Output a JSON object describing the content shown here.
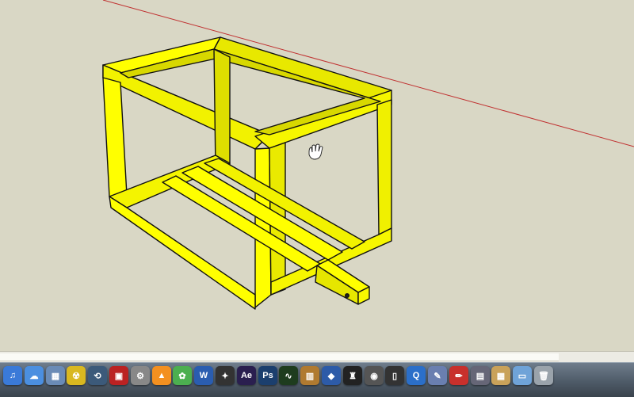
{
  "canvas": {
    "background": "#d9d7c5",
    "model": "yellow box frame",
    "model_color": "#ffff00",
    "edge_color": "#111111",
    "axis_color": "#c03030",
    "cursor": "hand-pan-icon"
  },
  "dock": {
    "items": [
      {
        "name": "itunes-icon",
        "glyph": "♫",
        "bg": "#3a7ad8"
      },
      {
        "name": "ichat-icon",
        "glyph": "☁",
        "bg": "#4b8fe0"
      },
      {
        "name": "preview-icon",
        "glyph": "▦",
        "bg": "#6a8bb6"
      },
      {
        "name": "radiation-app-icon",
        "glyph": "☢",
        "bg": "#d9b820"
      },
      {
        "name": "time-machine-icon",
        "glyph": "⟲",
        "bg": "#3c5a7a"
      },
      {
        "name": "photo-booth-icon",
        "glyph": "▣",
        "bg": "#b22"
      },
      {
        "name": "disk-utility-icon",
        "glyph": "⚙",
        "bg": "#888"
      },
      {
        "name": "vlc-icon",
        "glyph": "▲",
        "bg": "#f39020"
      },
      {
        "name": "green-app-icon",
        "glyph": "✿",
        "bg": "#4caf50"
      },
      {
        "name": "word-icon",
        "glyph": "W",
        "bg": "#2a5db0"
      },
      {
        "name": "star-app-icon",
        "glyph": "✦",
        "bg": "#333"
      },
      {
        "name": "after-effects-icon",
        "glyph": "Ae",
        "bg": "#2a1f4f"
      },
      {
        "name": "photoshop-icon",
        "glyph": "Ps",
        "bg": "#1b3f6e"
      },
      {
        "name": "activity-monitor-icon",
        "glyph": "∿",
        "bg": "#1e3c1e"
      },
      {
        "name": "stuffit-icon",
        "glyph": "▥",
        "bg": "#b07a30"
      },
      {
        "name": "unity-icon",
        "glyph": "◆",
        "bg": "#2d5ba8"
      },
      {
        "name": "top-hat-icon",
        "glyph": "♜",
        "bg": "#222"
      },
      {
        "name": "disc-icon",
        "glyph": "◉",
        "bg": "#555"
      },
      {
        "name": "phone-icon",
        "glyph": "▯",
        "bg": "#333"
      },
      {
        "name": "quicktime-icon",
        "glyph": "Q",
        "bg": "#2b6fc9"
      },
      {
        "name": "xcode-icon",
        "glyph": "✎",
        "bg": "#6a7fb0"
      },
      {
        "name": "pencil-app-icon",
        "glyph": "✏",
        "bg": "#c8302c"
      },
      {
        "name": "photo-app-icon",
        "glyph": "▤",
        "bg": "#667"
      },
      {
        "name": "documents-folder-icon",
        "glyph": "▦",
        "bg": "#c9a25a"
      },
      {
        "name": "folder-icon",
        "glyph": "▭",
        "bg": "#6fa3d8"
      },
      {
        "name": "trash-icon",
        "glyph": "🗑",
        "bg": "#9aa3ab"
      }
    ]
  }
}
